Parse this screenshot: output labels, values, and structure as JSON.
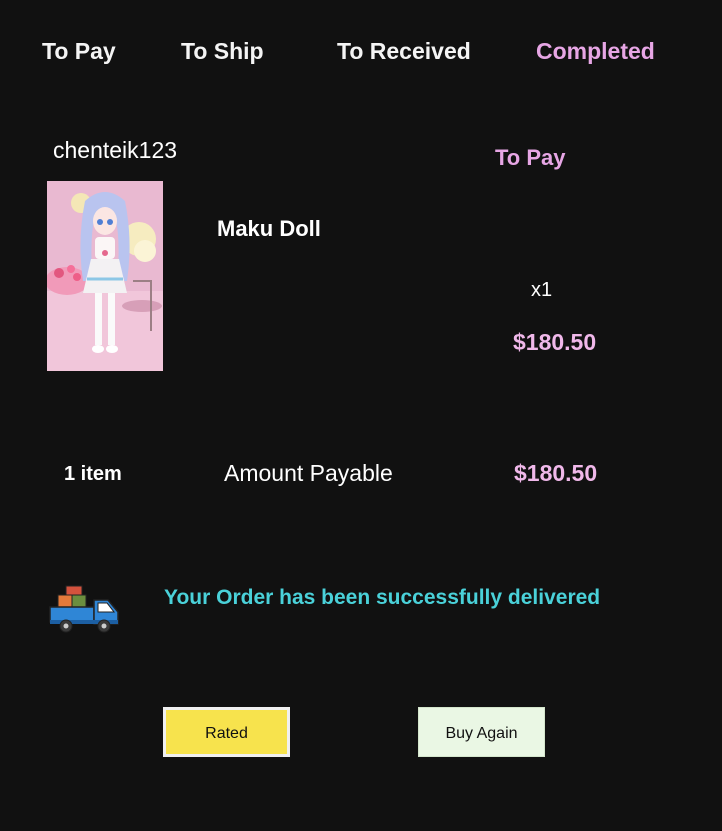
{
  "tabs": [
    {
      "label": "To Pay",
      "active": false
    },
    {
      "label": "To Ship",
      "active": false
    },
    {
      "label": "To Received",
      "active": false
    },
    {
      "label": "Completed",
      "active": true
    }
  ],
  "order": {
    "seller": "chenteik123",
    "status": "To Pay",
    "product": {
      "name": "Maku Doll",
      "quantity": "x1",
      "price": "$180.50",
      "image_icon": "doll-product-image"
    },
    "summary": {
      "item_count": "1 item",
      "payable_label": "Amount Payable",
      "payable_value": "$180.50"
    },
    "delivery": {
      "icon": "delivery-truck-icon",
      "message": "Your Order has been successfully delivered"
    },
    "actions": {
      "rated_label": "Rated",
      "buy_again_label": "Buy Again"
    }
  },
  "colors": {
    "background": "#111111",
    "accent_pink": "#e7a6e5",
    "delivered_cyan": "#4ad1d9",
    "rated_yellow": "#f7e34d",
    "buy_again_green": "#eaf7e4"
  }
}
